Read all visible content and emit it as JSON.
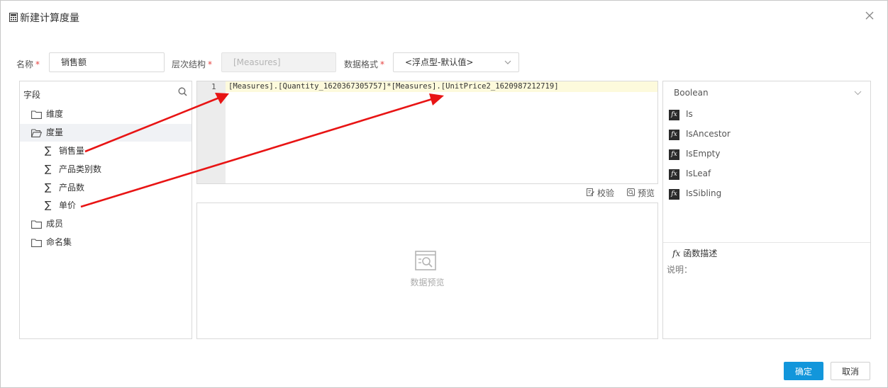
{
  "dialog": {
    "title": "新建计算度量"
  },
  "form": {
    "name_label": "名称",
    "name_value": "销售额",
    "level_label": "层次结构",
    "level_value": "[Measures]",
    "format_label": "数据格式",
    "format_value": "<浮点型-默认值>",
    "required_mark": "*"
  },
  "fields": {
    "header": "字段",
    "tree": [
      {
        "label": "维度",
        "type": "folder"
      },
      {
        "label": "度量",
        "type": "folder-open"
      },
      {
        "label": "销售量",
        "type": "measure"
      },
      {
        "label": "产品类别数",
        "type": "measure"
      },
      {
        "label": "产品数",
        "type": "measure"
      },
      {
        "label": "单价",
        "type": "measure"
      },
      {
        "label": "成员",
        "type": "folder"
      },
      {
        "label": "命名集",
        "type": "folder"
      }
    ]
  },
  "editor": {
    "line_number": "1",
    "expression": "[Measures].[Quantity_1620367305757]*[Measures].[UnitPrice2_1620987212719]"
  },
  "tools": {
    "validate": "校验",
    "preview": "预览"
  },
  "preview": {
    "placeholder": "数据预览"
  },
  "functions": {
    "category": "Boolean",
    "items": [
      "Is",
      "IsAncestor",
      "IsEmpty",
      "IsLeaf",
      "IsSibling"
    ],
    "fx_glyph": "fx",
    "desc_title": "函数描述",
    "desc_label": "说明："
  },
  "buttons": {
    "ok": "确定",
    "cancel": "取消"
  },
  "colors": {
    "primary": "#1296db",
    "annotation_arrow": "#e81414",
    "required": "#e64340"
  }
}
